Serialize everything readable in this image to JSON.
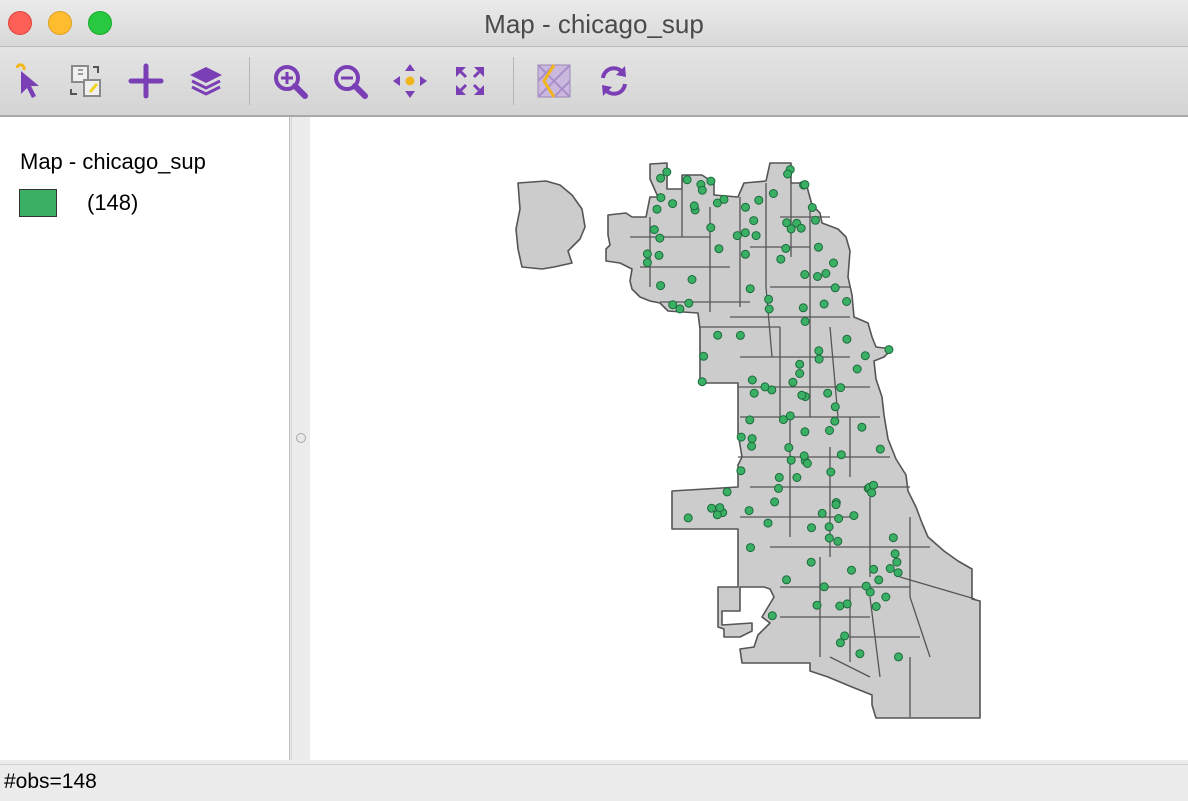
{
  "window": {
    "title": "Map - chicago_sup"
  },
  "toolbar": {
    "tools": [
      {
        "icon": "select-arrow-icon"
      },
      {
        "icon": "selection-shape-icon"
      },
      {
        "icon": "add-layer-icon"
      },
      {
        "icon": "layers-icon"
      },
      {
        "icon": "zoom-in-icon"
      },
      {
        "icon": "zoom-out-icon"
      },
      {
        "icon": "pan-icon"
      },
      {
        "icon": "full-extent-icon"
      },
      {
        "icon": "basemap-icon"
      },
      {
        "icon": "refresh-icon"
      }
    ],
    "accent_color": "#7b3fb5"
  },
  "legend": {
    "title": "Map - chicago_sup",
    "count_label": "(148)",
    "swatch_color": "#3ab065"
  },
  "map": {
    "fill_color": "#cccccc",
    "outline_color": "#555555",
    "point_color": "#3ab065",
    "n_points": 148
  },
  "status": {
    "text": "#obs=148"
  }
}
